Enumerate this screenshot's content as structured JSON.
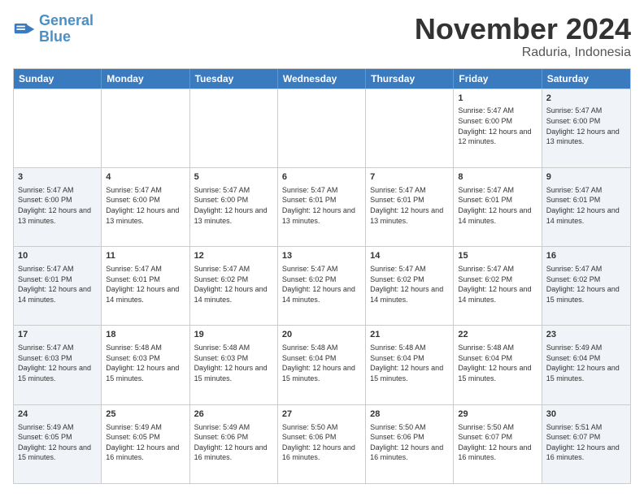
{
  "header": {
    "logo_general": "General",
    "logo_blue": "Blue",
    "month_title": "November 2024",
    "subtitle": "Raduria, Indonesia"
  },
  "calendar": {
    "days_of_week": [
      "Sunday",
      "Monday",
      "Tuesday",
      "Wednesday",
      "Thursday",
      "Friday",
      "Saturday"
    ],
    "rows": [
      [
        {
          "day": "",
          "empty": true
        },
        {
          "day": "",
          "empty": true
        },
        {
          "day": "",
          "empty": true
        },
        {
          "day": "",
          "empty": true
        },
        {
          "day": "",
          "empty": true
        },
        {
          "day": "1",
          "sunrise": "5:47 AM",
          "sunset": "6:00 PM",
          "daylight": "12 hours and 12 minutes."
        },
        {
          "day": "2",
          "sunrise": "5:47 AM",
          "sunset": "6:00 PM",
          "daylight": "12 hours and 13 minutes."
        }
      ],
      [
        {
          "day": "3",
          "sunrise": "5:47 AM",
          "sunset": "6:00 PM",
          "daylight": "12 hours and 13 minutes."
        },
        {
          "day": "4",
          "sunrise": "5:47 AM",
          "sunset": "6:00 PM",
          "daylight": "12 hours and 13 minutes."
        },
        {
          "day": "5",
          "sunrise": "5:47 AM",
          "sunset": "6:00 PM",
          "daylight": "12 hours and 13 minutes."
        },
        {
          "day": "6",
          "sunrise": "5:47 AM",
          "sunset": "6:01 PM",
          "daylight": "12 hours and 13 minutes."
        },
        {
          "day": "7",
          "sunrise": "5:47 AM",
          "sunset": "6:01 PM",
          "daylight": "12 hours and 13 minutes."
        },
        {
          "day": "8",
          "sunrise": "5:47 AM",
          "sunset": "6:01 PM",
          "daylight": "12 hours and 14 minutes."
        },
        {
          "day": "9",
          "sunrise": "5:47 AM",
          "sunset": "6:01 PM",
          "daylight": "12 hours and 14 minutes."
        }
      ],
      [
        {
          "day": "10",
          "sunrise": "5:47 AM",
          "sunset": "6:01 PM",
          "daylight": "12 hours and 14 minutes."
        },
        {
          "day": "11",
          "sunrise": "5:47 AM",
          "sunset": "6:01 PM",
          "daylight": "12 hours and 14 minutes."
        },
        {
          "day": "12",
          "sunrise": "5:47 AM",
          "sunset": "6:02 PM",
          "daylight": "12 hours and 14 minutes."
        },
        {
          "day": "13",
          "sunrise": "5:47 AM",
          "sunset": "6:02 PM",
          "daylight": "12 hours and 14 minutes."
        },
        {
          "day": "14",
          "sunrise": "5:47 AM",
          "sunset": "6:02 PM",
          "daylight": "12 hours and 14 minutes."
        },
        {
          "day": "15",
          "sunrise": "5:47 AM",
          "sunset": "6:02 PM",
          "daylight": "12 hours and 14 minutes."
        },
        {
          "day": "16",
          "sunrise": "5:47 AM",
          "sunset": "6:02 PM",
          "daylight": "12 hours and 15 minutes."
        }
      ],
      [
        {
          "day": "17",
          "sunrise": "5:47 AM",
          "sunset": "6:03 PM",
          "daylight": "12 hours and 15 minutes."
        },
        {
          "day": "18",
          "sunrise": "5:48 AM",
          "sunset": "6:03 PM",
          "daylight": "12 hours and 15 minutes."
        },
        {
          "day": "19",
          "sunrise": "5:48 AM",
          "sunset": "6:03 PM",
          "daylight": "12 hours and 15 minutes."
        },
        {
          "day": "20",
          "sunrise": "5:48 AM",
          "sunset": "6:04 PM",
          "daylight": "12 hours and 15 minutes."
        },
        {
          "day": "21",
          "sunrise": "5:48 AM",
          "sunset": "6:04 PM",
          "daylight": "12 hours and 15 minutes."
        },
        {
          "day": "22",
          "sunrise": "5:48 AM",
          "sunset": "6:04 PM",
          "daylight": "12 hours and 15 minutes."
        },
        {
          "day": "23",
          "sunrise": "5:49 AM",
          "sunset": "6:04 PM",
          "daylight": "12 hours and 15 minutes."
        }
      ],
      [
        {
          "day": "24",
          "sunrise": "5:49 AM",
          "sunset": "6:05 PM",
          "daylight": "12 hours and 15 minutes."
        },
        {
          "day": "25",
          "sunrise": "5:49 AM",
          "sunset": "6:05 PM",
          "daylight": "12 hours and 16 minutes."
        },
        {
          "day": "26",
          "sunrise": "5:49 AM",
          "sunset": "6:06 PM",
          "daylight": "12 hours and 16 minutes."
        },
        {
          "day": "27",
          "sunrise": "5:50 AM",
          "sunset": "6:06 PM",
          "daylight": "12 hours and 16 minutes."
        },
        {
          "day": "28",
          "sunrise": "5:50 AM",
          "sunset": "6:06 PM",
          "daylight": "12 hours and 16 minutes."
        },
        {
          "day": "29",
          "sunrise": "5:50 AM",
          "sunset": "6:07 PM",
          "daylight": "12 hours and 16 minutes."
        },
        {
          "day": "30",
          "sunrise": "5:51 AM",
          "sunset": "6:07 PM",
          "daylight": "12 hours and 16 minutes."
        }
      ]
    ]
  }
}
